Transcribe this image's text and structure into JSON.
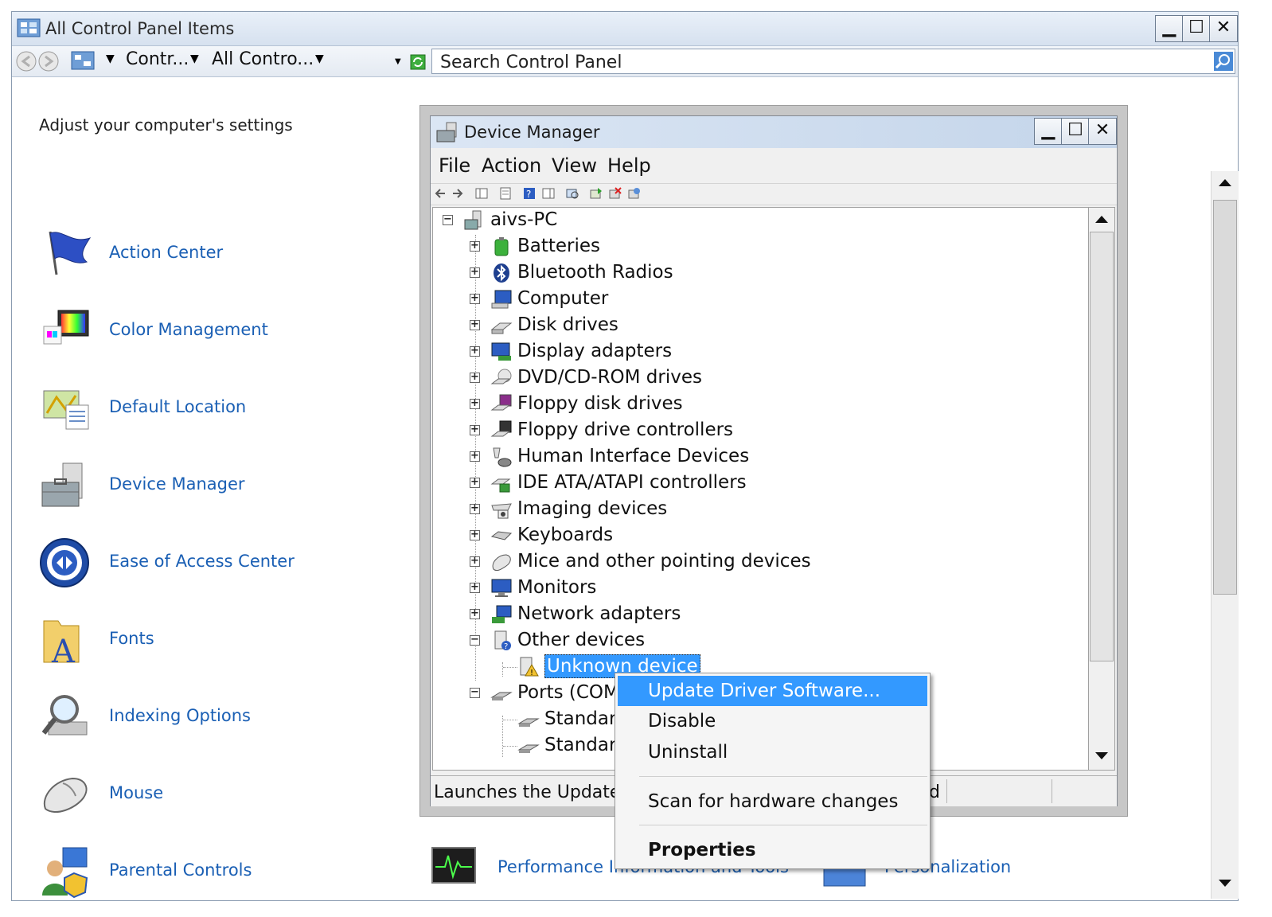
{
  "window": {
    "title": "All Control Panel Items",
    "breadcrumb": [
      "Contr...",
      "All Contro..."
    ],
    "search_placeholder": "Search Control Panel"
  },
  "control_panel": {
    "heading": "Adjust your computer's settings",
    "items": [
      {
        "label": "Action Center",
        "icon": "flag-icon"
      },
      {
        "label": "Color Management",
        "icon": "color-management-icon"
      },
      {
        "label": "Default Location",
        "icon": "location-icon"
      },
      {
        "label": "Device Manager",
        "icon": "device-manager-icon"
      },
      {
        "label": "Ease of Access Center",
        "icon": "ease-of-access-icon"
      },
      {
        "label": "Fonts",
        "icon": "fonts-folder-icon"
      },
      {
        "label": "Indexing Options",
        "icon": "magnifier-icon"
      },
      {
        "label": "Mouse",
        "icon": "mouse-icon"
      },
      {
        "label": "Parental Controls",
        "icon": "parental-controls-icon"
      }
    ],
    "bottom_items": [
      {
        "label": "Performance Information and Tools",
        "icon": "performance-icon"
      },
      {
        "label": "Personalization",
        "icon": "personalization-icon"
      }
    ]
  },
  "device_manager": {
    "title": "Device Manager",
    "menu": [
      "File",
      "Action",
      "View",
      "Help"
    ],
    "root": "aivs-PC",
    "tree": [
      {
        "label": "Batteries",
        "state": "collapsed"
      },
      {
        "label": "Bluetooth Radios",
        "state": "collapsed"
      },
      {
        "label": "Computer",
        "state": "collapsed"
      },
      {
        "label": "Disk drives",
        "state": "collapsed"
      },
      {
        "label": "Display adapters",
        "state": "collapsed"
      },
      {
        "label": "DVD/CD-ROM drives",
        "state": "collapsed"
      },
      {
        "label": "Floppy disk drives",
        "state": "collapsed"
      },
      {
        "label": "Floppy drive controllers",
        "state": "collapsed"
      },
      {
        "label": "Human Interface Devices",
        "state": "collapsed"
      },
      {
        "label": "IDE ATA/ATAPI controllers",
        "state": "collapsed"
      },
      {
        "label": "Imaging devices",
        "state": "collapsed"
      },
      {
        "label": "Keyboards",
        "state": "collapsed"
      },
      {
        "label": "Mice and other pointing devices",
        "state": "collapsed"
      },
      {
        "label": "Monitors",
        "state": "collapsed"
      },
      {
        "label": "Network adapters",
        "state": "collapsed"
      },
      {
        "label": "Other devices",
        "state": "expanded"
      },
      {
        "label": "Unknown device",
        "state": "child-selected"
      },
      {
        "label": "Ports (COM",
        "state": "expanded"
      },
      {
        "label": "Standard",
        "state": "child"
      },
      {
        "label": "Standard",
        "state": "child"
      }
    ],
    "status": "Launches the Update",
    "status_tail": "d"
  },
  "context_menu": {
    "items": [
      "Update Driver Software...",
      "Disable",
      "Uninstall",
      "Scan for hardware changes",
      "Properties"
    ],
    "highlighted": "Update Driver Software...",
    "bold": "Properties"
  },
  "colors": {
    "link": "#1a5fb4",
    "highlight": "#3399ff",
    "title_gradient": "#d6e1ef"
  }
}
